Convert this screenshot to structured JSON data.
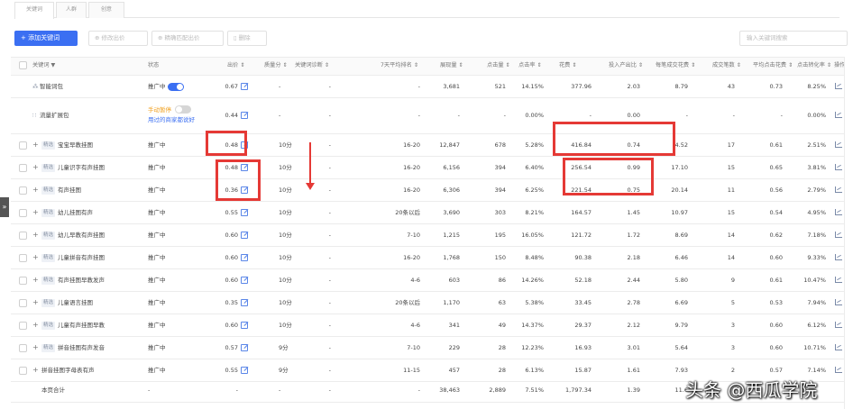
{
  "tabs": [
    "关键词",
    "人群",
    "创意"
  ],
  "toolbar": {
    "add_label": "+ 添加关键词",
    "modify_bid_label": "修改出价",
    "smart_match_label": "精确匹配出价",
    "delete_label": "删除",
    "search_placeholder": "输入关键词搜索"
  },
  "columns": [
    "关键词 ▼",
    "状态",
    "出价 ⇕",
    "质量分 ⇕",
    "关键词诊断 ⇕",
    "7天平均排名 ⇕",
    "展现量 ⇕",
    "点击量 ⇕",
    "点击率 ⇕",
    "花费 ⇕",
    "投入产出比 ⇕",
    "每笔成交花费 ⇕",
    "成交笔数 ⇕",
    "平均点击花费 ⇕",
    "点击转化率 ⇕",
    "操作"
  ],
  "rows": [
    {
      "name": "智能词包",
      "tag": "",
      "status": "推广中",
      "bid": "0.67",
      "quality": "-",
      "diag": "-",
      "rank": "-",
      "impr": "3,681",
      "clicks": "521",
      "ctr": "14.15%",
      "cost": "377.96",
      "roi": "2.03",
      "cpo": "8.79",
      "orders": "43",
      "cpc": "0.73",
      "cvr": "8.25%"
    },
    {
      "name": "流量扩展包",
      "tag": "",
      "status": "手动暂停",
      "status_link": "用过的商家都说好",
      "bid": "0.44",
      "quality": "-",
      "diag": "-",
      "rank": "-",
      "impr": "-",
      "clicks": "-",
      "ctr": "0.00%",
      "cost": "-",
      "roi": "0.00",
      "cpo": "-",
      "orders": "-",
      "cpc": "-",
      "cvr": "0.00%"
    },
    {
      "name": "宝宝早教挂图",
      "tag": "精选",
      "status": "推广中",
      "bid": "0.48",
      "quality": "10分",
      "diag": "-",
      "rank": "16-20",
      "impr": "12,847",
      "clicks": "678",
      "ctr": "5.28%",
      "cost": "416.84",
      "roi": "0.74",
      "cpo": "4.52",
      "orders": "17",
      "cpc": "0.61",
      "cvr": "2.51%"
    },
    {
      "name": "儿童识字有声挂图",
      "tag": "精选",
      "status": "推广中",
      "bid": "0.48",
      "quality": "10分",
      "diag": "-",
      "rank": "16-20",
      "impr": "6,156",
      "clicks": "394",
      "ctr": "6.40%",
      "cost": "256.54",
      "roi": "0.99",
      "cpo": "17.10",
      "orders": "15",
      "cpc": "0.65",
      "cvr": "3.81%"
    },
    {
      "name": "有声挂图",
      "tag": "精选",
      "status": "推广中",
      "bid": "0.36",
      "quality": "10分",
      "diag": "-",
      "rank": "16-20",
      "impr": "6,306",
      "clicks": "394",
      "ctr": "6.25%",
      "cost": "221.54",
      "roi": "0.75",
      "cpo": "20.14",
      "orders": "11",
      "cpc": "0.56",
      "cvr": "2.79%"
    },
    {
      "name": "幼儿挂图有声",
      "tag": "精选",
      "status": "推广中",
      "bid": "0.55",
      "quality": "10分",
      "diag": "-",
      "rank": "20条以后",
      "impr": "3,690",
      "clicks": "303",
      "ctr": "8.21%",
      "cost": "164.57",
      "roi": "1.45",
      "cpo": "10.97",
      "orders": "15",
      "cpc": "0.54",
      "cvr": "4.95%"
    },
    {
      "name": "幼儿早教有声挂图",
      "tag": "精选",
      "status": "推广中",
      "bid": "0.60",
      "quality": "10分",
      "diag": "-",
      "rank": "7-10",
      "impr": "1,215",
      "clicks": "195",
      "ctr": "16.05%",
      "cost": "121.72",
      "roi": "1.72",
      "cpo": "8.69",
      "orders": "14",
      "cpc": "0.62",
      "cvr": "7.18%"
    },
    {
      "name": "儿童拼音有声挂图",
      "tag": "精选",
      "status": "推广中",
      "bid": "0.60",
      "quality": "10分",
      "diag": "-",
      "rank": "16-20",
      "impr": "1,768",
      "clicks": "150",
      "ctr": "8.48%",
      "cost": "90.38",
      "roi": "2.18",
      "cpo": "6.46",
      "orders": "14",
      "cpc": "0.60",
      "cvr": "9.33%"
    },
    {
      "name": "有声挂图早教发声",
      "tag": "精选",
      "status": "推广中",
      "bid": "0.60",
      "quality": "10分",
      "diag": "-",
      "rank": "4-6",
      "impr": "603",
      "clicks": "86",
      "ctr": "14.26%",
      "cost": "52.18",
      "roi": "2.44",
      "cpo": "5.80",
      "orders": "9",
      "cpc": "0.61",
      "cvr": "10.47%"
    },
    {
      "name": "儿童语言挂图",
      "tag": "精选",
      "status": "推广中",
      "bid": "0.35",
      "quality": "10分",
      "diag": "-",
      "rank": "20条以后",
      "impr": "1,170",
      "clicks": "63",
      "ctr": "5.38%",
      "cost": "33.45",
      "roi": "2.78",
      "cpo": "6.69",
      "orders": "5",
      "cpc": "0.53",
      "cvr": "7.94%"
    },
    {
      "name": "儿童有声挂图早教",
      "tag": "精选",
      "status": "推广中",
      "bid": "0.60",
      "quality": "10分",
      "diag": "-",
      "rank": "4-6",
      "impr": "341",
      "clicks": "49",
      "ctr": "14.37%",
      "cost": "29.37",
      "roi": "2.12",
      "cpo": "9.79",
      "orders": "3",
      "cpc": "0.60",
      "cvr": "6.12%"
    },
    {
      "name": "拼音挂图有声发音",
      "tag": "精选",
      "status": "推广中",
      "bid": "0.57",
      "quality": "9分",
      "diag": "-",
      "rank": "7-10",
      "impr": "229",
      "clicks": "28",
      "ctr": "12.23%",
      "cost": "16.93",
      "roi": "3.01",
      "cpo": "5.64",
      "orders": "3",
      "cpc": "0.60",
      "cvr": "10.71%"
    },
    {
      "name": "拼音挂图字母表有声",
      "tag": "",
      "status": "推广中",
      "bid": "0.55",
      "quality": "9分",
      "diag": "-",
      "rank": "11-15",
      "impr": "457",
      "clicks": "28",
      "ctr": "6.13%",
      "cost": "15.87",
      "roi": "1.61",
      "cpo": "7.93",
      "orders": "2",
      "cpc": "0.57",
      "cvr": "7.14%"
    }
  ],
  "total": {
    "name": "本页合计",
    "status": "-",
    "bid": "-",
    "quality": "-",
    "diag": "-",
    "rank": "-",
    "impr": "38,463",
    "clicks": "2,889",
    "ctr": "7.51%",
    "cost": "1,797.34",
    "roi": "1.39",
    "cpo": "11.6"
  },
  "side_handle": "»",
  "watermark": "头条 @西瓜学院",
  "colors": {
    "accent": "#3b6ff2",
    "annotation": "#e53935",
    "paused": "#f0a020"
  }
}
